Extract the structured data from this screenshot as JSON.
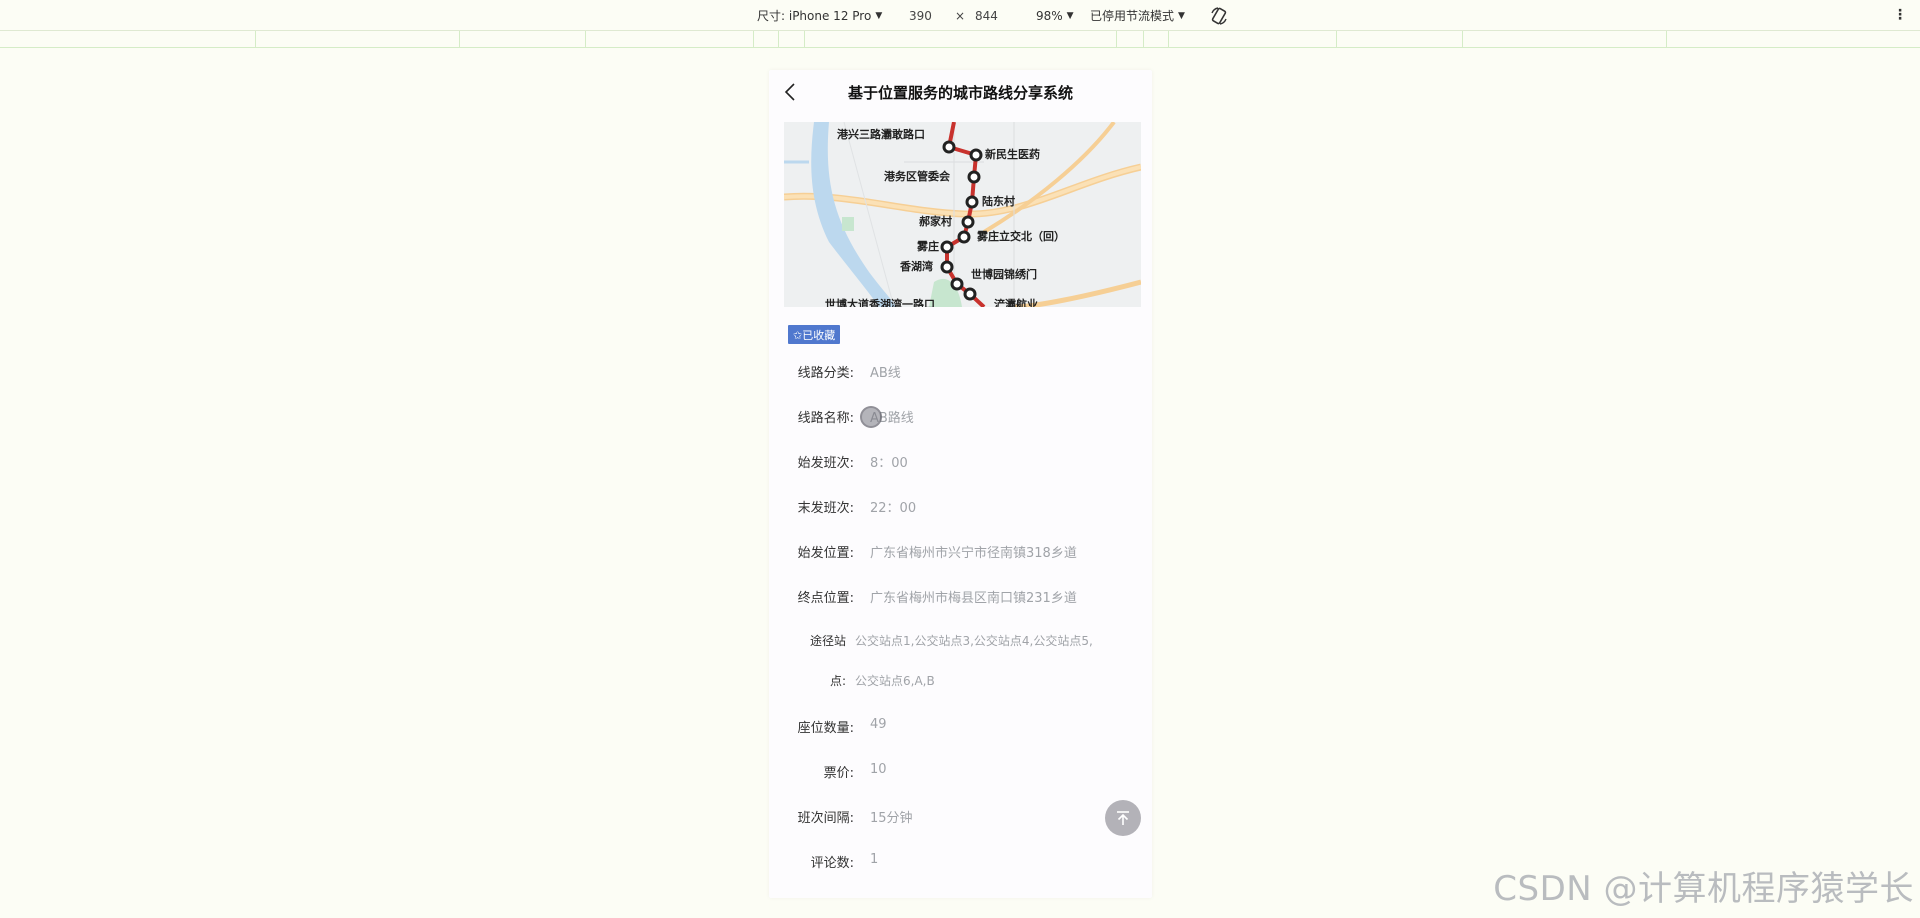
{
  "devtools": {
    "device_label": "尺寸: iPhone 12 Pro",
    "width": "390",
    "times": "×",
    "height": "844",
    "zoom": "98%",
    "throttle": "已停用节流模式"
  },
  "app": {
    "title": "基于位置服务的城市路线分享系统",
    "favorite_label": "✩已收藏",
    "map": {
      "stops": [
        "港兴三路灞敢路口",
        "新民生医药",
        "港务区管委会",
        "陆东村",
        "郝家村",
        "雾庄立交北（回）",
        "雾庄",
        "香湖湾",
        "世博园锦绣门",
        "世博大道香湖湾一路口",
        "浐灞航业"
      ]
    },
    "details": [
      {
        "label": "线路分类:",
        "value": "AB线"
      },
      {
        "label": "线路名称:",
        "value": "AB路线"
      },
      {
        "label": "始发班次:",
        "value": "8：00"
      },
      {
        "label": "末发班次:",
        "value": "22：00"
      },
      {
        "label": "始发位置:",
        "value": "广东省梅州市兴宁市径南镇318乡道"
      },
      {
        "label": "终点位置:",
        "value": "广东省梅州市梅县区南口镇231乡道"
      },
      {
        "label": "座位数量:",
        "value": "49"
      },
      {
        "label": "票价:",
        "value": "10"
      },
      {
        "label": "班次间隔:",
        "value": "15分钟"
      },
      {
        "label": "评论数:",
        "value": "1"
      }
    ],
    "stations": {
      "label_line1": "途径站",
      "label_line2": "点:",
      "value_line1": "公交站点1,公交站点3,公交站点4,公交站点5,",
      "value_line2": "公交站点6,A,B"
    }
  },
  "watermark": "CSDN @计算机程序猿学长",
  "colors": {
    "accent": "#5078ce",
    "route": "#c8322d",
    "value_text": "#a0a3a8"
  }
}
